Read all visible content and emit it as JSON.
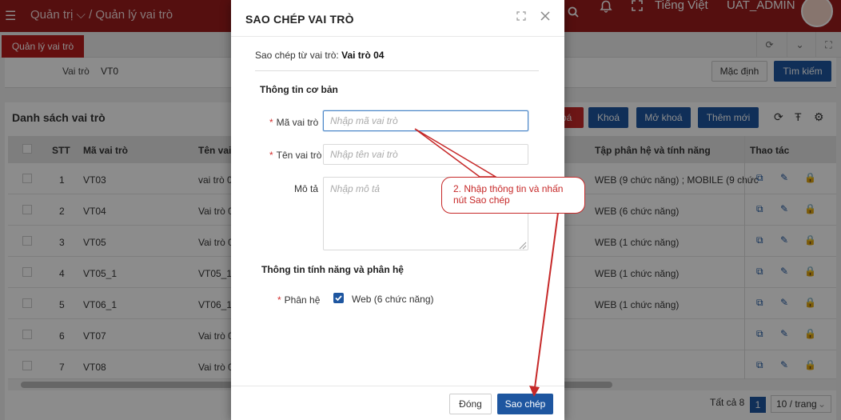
{
  "header": {
    "breadcrumb_root": "Quản trị",
    "breadcrumb_current": "Quản lý vai trò",
    "language": "Tiếng Việt",
    "user": "UAT_ADMIN"
  },
  "tabs": {
    "active": "Quản lý vai trò"
  },
  "filter": {
    "role_label": "Vai trò",
    "role_value": "VT0",
    "default_button": "Mặc định",
    "search_button": "Tìm kiếm"
  },
  "list": {
    "title": "Danh sách vai trò",
    "red_button_partial": "oá",
    "lock_button": "Khoá",
    "unlock_button": "Mở khoá",
    "add_button": "Thêm mới",
    "columns": {
      "stt": "STT",
      "code": "Mã vai trò",
      "name_partial": "Tên vai",
      "modules": "Tập phân hệ và tính năng",
      "actions": "Thao tác"
    },
    "rows": [
      {
        "stt": "1",
        "code": "VT03",
        "name": "vai trò 0",
        "modules": "WEB (9 chức năng) ; MOBILE (9 chức"
      },
      {
        "stt": "2",
        "code": "VT04",
        "name": "Vai trò 0",
        "modules": "WEB (6 chức năng)"
      },
      {
        "stt": "3",
        "code": "VT05",
        "name": "Vai trò 0",
        "modules": "WEB (1 chức năng)"
      },
      {
        "stt": "4",
        "code": "VT05_1",
        "name": "VT05_1",
        "modules": "WEB (1 chức năng)"
      },
      {
        "stt": "5",
        "code": "VT06_1",
        "name": "VT06_1",
        "modules": "WEB (1 chức năng)"
      },
      {
        "stt": "6",
        "code": "VT07",
        "name": "Vai trò 0",
        "modules": ""
      },
      {
        "stt": "7",
        "code": "VT08",
        "name": "Vai trò 0",
        "modules": ""
      }
    ],
    "total_label": "Tất cả 8",
    "current_page": "1",
    "page_size": "10 / trang"
  },
  "modal": {
    "title": "SAO CHÉP VAI TRÒ",
    "copy_from_label": "Sao chép từ vai trò:",
    "copy_from_value": "Vai trò 04",
    "section_basic": "Thông tin cơ bản",
    "code_label": "Mã vai trò",
    "code_placeholder": "Nhập mã vai trò",
    "name_label": "Tên vai trò",
    "name_placeholder": "Nhập tên vai trò",
    "desc_label": "Mô tả",
    "desc_placeholder": "Nhập mô tả",
    "section_features": "Thông tin tính năng và phân hệ",
    "module_label": "Phân hệ",
    "module_option": "Web (6 chức năng)",
    "close_button": "Đóng",
    "copy_button": "Sao chép"
  },
  "annotation": {
    "text": "2. Nhập thông tin và nhấn nút Sao chép",
    "color": "#c62828"
  }
}
